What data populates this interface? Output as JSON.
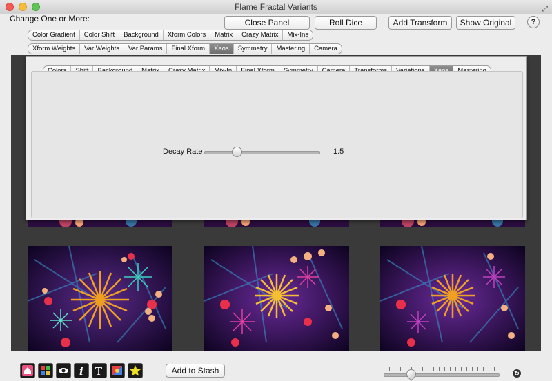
{
  "window": {
    "title": "Flame Fractal Variants"
  },
  "header": {
    "change_label": "Change One or More:",
    "buttons": {
      "close_panel": "Close Panel",
      "roll_dice": "Roll Dice",
      "add_transform": "Add Transform",
      "show_original": "Show Original",
      "help": "?"
    }
  },
  "categories_row1": [
    "Color Gradient",
    "Color Shift",
    "Background",
    "Xform Colors",
    "Matrix",
    "Crazy Matrix",
    "Mix-Ins"
  ],
  "categories_row2": [
    "Xform Weights",
    "Var Weights",
    "Var Params",
    "Final Xform",
    "Xaos",
    "Symmetry",
    "Mastering",
    "Camera"
  ],
  "categories_row2_selected": "Xaos",
  "panel": {
    "tabs": [
      "Colors",
      "Shift",
      "Background",
      "Matrix",
      "Crazy Matrix",
      "Mix-In",
      "Final Xform",
      "Symmetry",
      "Camera",
      "Transforms",
      "Variations",
      "Xaos",
      "Mastering"
    ],
    "selected_tab": "Xaos",
    "slider": {
      "label": "Decay Rate",
      "value": "1.5"
    }
  },
  "footer": {
    "tools": [
      "home-icon",
      "grid-icon",
      "eye-icon",
      "info-icon",
      "text-icon",
      "palette-icon",
      "star-icon"
    ],
    "add_to_stash": "Add to Stash",
    "zoom_level": 0.22
  },
  "colors": {
    "dark_area": "#3a3a3a",
    "selected_segment": "#7b7b7b"
  }
}
